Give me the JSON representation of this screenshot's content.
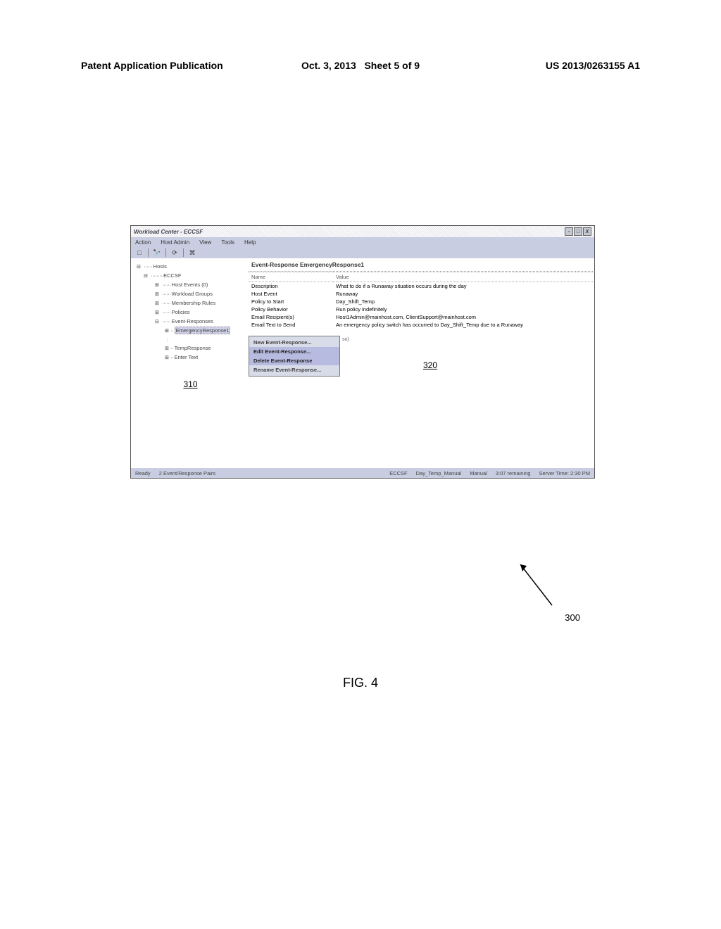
{
  "publication": {
    "type_label": "Patent Application Publication",
    "date": "Oct. 3, 2013",
    "sheet": "Sheet 5 of 9",
    "pub_no": "US 2013/0263155 A1"
  },
  "figure": {
    "label": "FIG. 4",
    "ref_300": "300",
    "ref_310": "310",
    "ref_320": "320"
  },
  "window": {
    "title": "Workload Center - ECCSF",
    "win_min": "-",
    "win_max": "□",
    "win_close": "X"
  },
  "menubar": {
    "items": [
      {
        "label": "Action"
      },
      {
        "label": "Host Admin"
      },
      {
        "label": "View"
      },
      {
        "label": "Tools"
      },
      {
        "label": "Help"
      }
    ]
  },
  "toolbar": {
    "new": "□",
    "binoc": "🔭",
    "refresh": "⟳",
    "wiz": "⌘"
  },
  "tree": {
    "root": "Hosts",
    "host": "ECCSF",
    "host_events": "Host Events (0)",
    "workload_groups": "Workload Groups",
    "membership_rules": "Membership Rules",
    "policies": "Policies",
    "event_responses": "Event-Responses",
    "emergency_response1": "EmergencyResponse1",
    "temp_response": "TempResponse",
    "enter_text": "Enter Text"
  },
  "detail": {
    "header": "Event-Response EmergencyResponse1",
    "col_name": "Name",
    "col_value": "Value",
    "rows": [
      {
        "name": "Description",
        "value": "What to do if a Runaway situation occurs during the day"
      },
      {
        "name": "Host Event",
        "value": "Runaway"
      },
      {
        "name": "Policy to Start",
        "value": "Day_Shift_Temp"
      },
      {
        "name": "Policy Behavior",
        "value": "Run policy indefinitely"
      },
      {
        "name": "Email Recipient(s)",
        "value": "Host1Admin@mainhost.com, ClientSupport@mainhost.com"
      },
      {
        "name": "Email Text to Send",
        "value": "An emergency policy switch has occurred to Day_Shift_Temp due to a Runaway"
      }
    ],
    "partial_so": "so)"
  },
  "context_menu": {
    "items": [
      {
        "label": "New Event-Response..."
      },
      {
        "label": "Edit Event-Response..."
      },
      {
        "label": "Delete Event-Response"
      },
      {
        "label": "Rename Event-Response..."
      }
    ]
  },
  "statusbar": {
    "ready": "Ready",
    "pairs": "2 Event/Response Pairs",
    "host": "ECCSF",
    "policy": "Day_Temp_Manual",
    "mode": "Manual",
    "remaining": "3:07 remaining",
    "server_time": "Server Time: 2:30 PM"
  }
}
